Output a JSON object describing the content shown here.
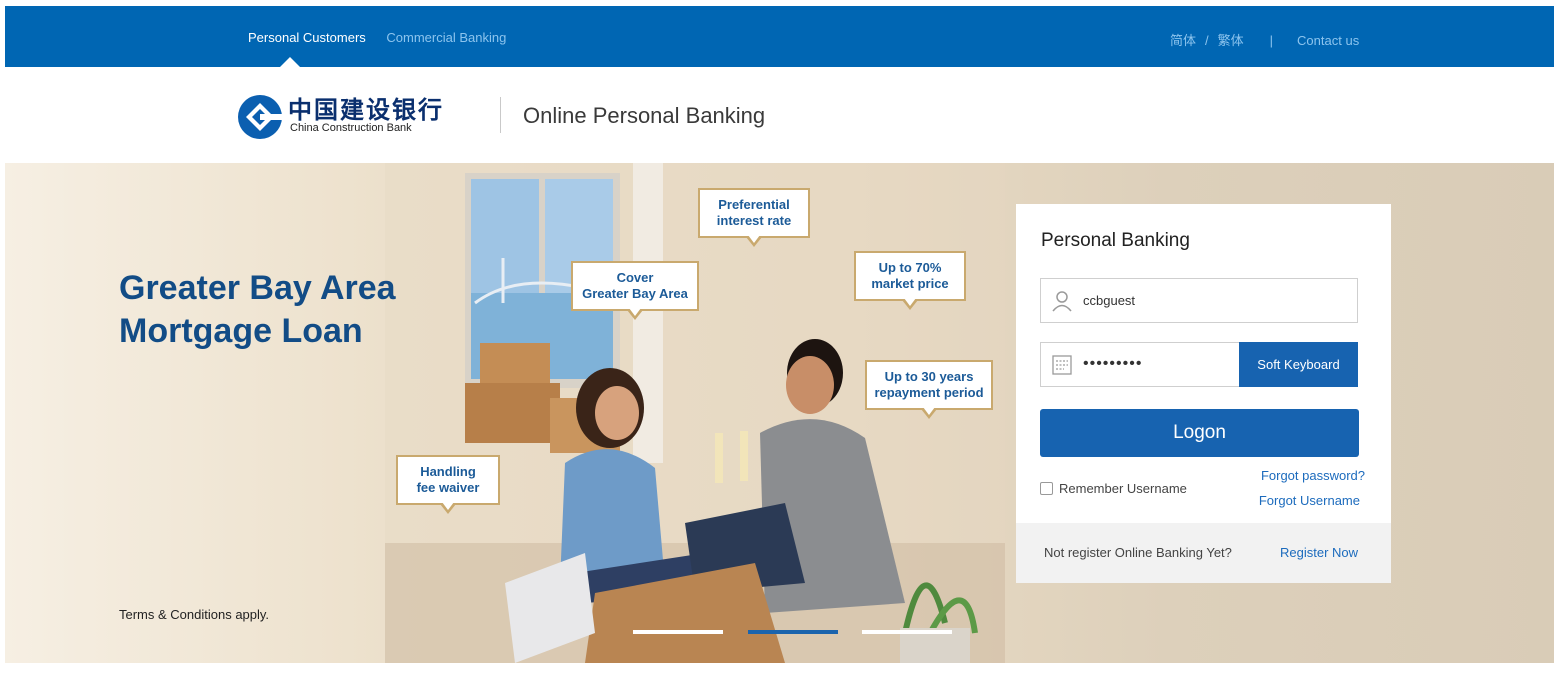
{
  "topbar": {
    "personal": "Personal Customers",
    "commercial": "Commercial Banking",
    "simplified": "简体",
    "slash": "/",
    "traditional": "繁体",
    "divider": "|",
    "contact": "Contact us"
  },
  "header": {
    "logo_cn": "中国建设银行",
    "logo_en": "China Construction Bank",
    "title": "Online Personal Banking"
  },
  "hero": {
    "title_line1": "Greater Bay Area",
    "title_line2": "Mortgage Loan",
    "terms": "Terms & Conditions apply.",
    "bubbles": {
      "preferential_1": "Preferential",
      "preferential_2": "interest rate",
      "cover_1": "Cover",
      "cover_2": "Greater Bay Area",
      "market_1": "Up to 70%",
      "market_2": "market price",
      "repay_1": "Up to 30 years",
      "repay_2": "repayment period",
      "fee_1": "Handling",
      "fee_2": "fee waiver"
    },
    "slides": {
      "count": 3,
      "active_index": 1
    }
  },
  "login": {
    "title": "Personal Banking",
    "username_value": "ccbguest",
    "password_value": "•••••••••",
    "soft_keyboard": "Soft Keyboard",
    "logon": "Logon",
    "remember": "Remember Username",
    "remember_checked": false,
    "forgot_password": "Forgot password?",
    "forgot_username": "Forgot Username",
    "not_registered": "Not register Online Banking Yet?",
    "register_now": "Register Now"
  },
  "colors": {
    "brand_blue": "#0066b3",
    "button_blue": "#1763b0",
    "link_blue": "#1c6bbd",
    "hero_title": "#124c86",
    "bubble_border": "#c9a96e"
  }
}
